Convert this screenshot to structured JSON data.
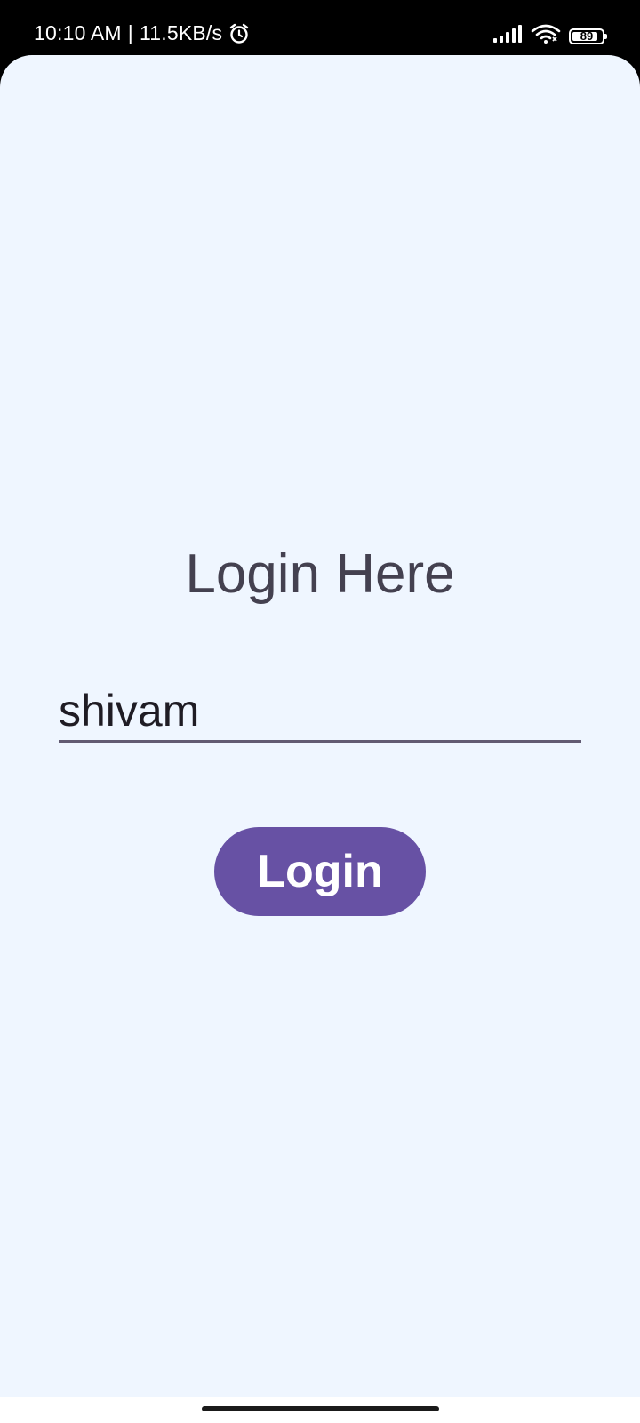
{
  "status_bar": {
    "time": "10:10 AM",
    "separator": "|",
    "network_speed": "11.5KB/s",
    "battery_level": "89",
    "icons": [
      "alarm-icon",
      "signal-icon",
      "wifi-icon",
      "battery-icon"
    ]
  },
  "login_screen": {
    "title": "Login Here",
    "username_value": "shivam",
    "login_button_label": "Login"
  },
  "colors": {
    "background": "#eff6ff",
    "button": "#6751a4",
    "title_text": "#444150",
    "field_underline": "#625b72"
  }
}
